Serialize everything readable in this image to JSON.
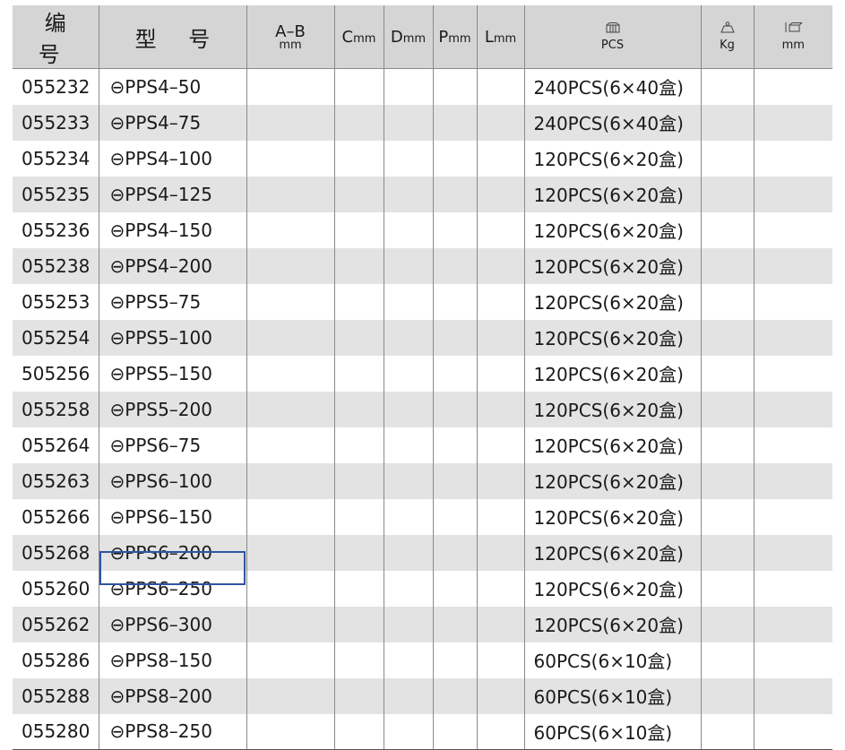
{
  "header": {
    "code": "编 号",
    "model": "型 号",
    "ab_top": "A–B",
    "ab_unit": "mm",
    "c_letter": "C",
    "c_unit": "mm",
    "d_letter": "D",
    "d_unit": "mm",
    "p_letter": "P",
    "p_unit": "mm",
    "l_letter": "L",
    "l_unit": "mm",
    "pcs_icon": "box-icon",
    "pcs": "PCS",
    "kg_icon": "weight-icon",
    "kg": "Kg",
    "dim_icon": "dimension-box-icon",
    "mm": "mm"
  },
  "rows": [
    {
      "code": "055232",
      "model": "⊖PPS4–50",
      "pack": "240PCS(6×40盒)"
    },
    {
      "code": "055233",
      "model": "⊖PPS4–75",
      "pack": "240PCS(6×40盒)"
    },
    {
      "code": "055234",
      "model": "⊖PPS4–100",
      "pack": "120PCS(6×20盒)"
    },
    {
      "code": "055235",
      "model": "⊖PPS4–125",
      "pack": "120PCS(6×20盒)"
    },
    {
      "code": "055236",
      "model": "⊖PPS4–150",
      "pack": "120PCS(6×20盒)"
    },
    {
      "code": "055238",
      "model": "⊖PPS4–200",
      "pack": "120PCS(6×20盒)"
    },
    {
      "code": "055253",
      "model": "⊖PPS5–75",
      "pack": "120PCS(6×20盒)"
    },
    {
      "code": "055254",
      "model": "⊖PPS5–100",
      "pack": "120PCS(6×20盒)"
    },
    {
      "code": "505256",
      "model": "⊖PPS5–150",
      "pack": "120PCS(6×20盒)"
    },
    {
      "code": "055258",
      "model": "⊖PPS5–200",
      "pack": "120PCS(6×20盒)"
    },
    {
      "code": "055264",
      "model": "⊖PPS6–75",
      "pack": "120PCS(6×20盒)"
    },
    {
      "code": "055263",
      "model": "⊖PPS6–100",
      "pack": "120PCS(6×20盒)"
    },
    {
      "code": "055266",
      "model": "⊖PPS6–150",
      "pack": "120PCS(6×20盒)"
    },
    {
      "code": "055268",
      "model": "⊖PPS6–200",
      "pack": "120PCS(6×20盒)"
    },
    {
      "code": "055260",
      "model": "⊖PPS6–250",
      "pack": "120PCS(6×20盒)"
    },
    {
      "code": "055262",
      "model": "⊖PPS6–300",
      "pack": "120PCS(6×20盒)"
    },
    {
      "code": "055286",
      "model": "⊖PPS8–150",
      "pack": "60PCS(6×10盒)"
    },
    {
      "code": "055288",
      "model": "⊖PPS8–200",
      "pack": "60PCS(6×10盒)"
    },
    {
      "code": "055280",
      "model": "⊖PPS8–250",
      "pack": "60PCS(6×10盒)"
    }
  ],
  "selection": {
    "row_code": "055260",
    "column": "model",
    "color": "#2f55a4"
  }
}
